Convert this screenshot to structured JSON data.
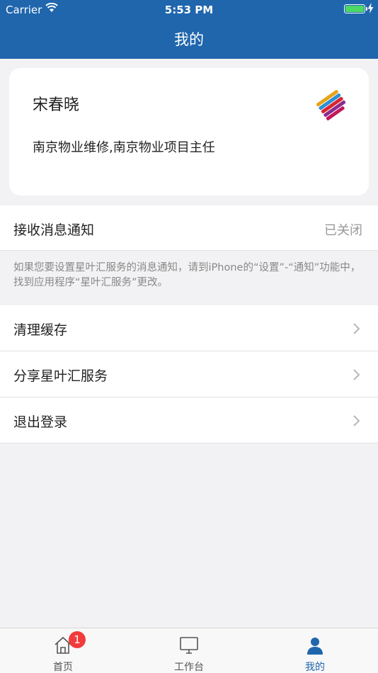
{
  "status_bar": {
    "carrier": "Carrier",
    "time": "5:53 PM",
    "battery_level": 1.0
  },
  "nav": {
    "title": "我的"
  },
  "profile": {
    "name": "宋春晓",
    "organization": "南京物业维修,南京物业项目主任"
  },
  "notification": {
    "label": "接收消息通知",
    "value": "已关闭",
    "hint": "如果您要设置星叶汇服务的消息通知，请到iPhone的“设置”-“通知”功能中，找到应用程序“星叶汇服务”更改。"
  },
  "actions": [
    {
      "label": "清理缓存",
      "icon": "chevron-right-icon"
    },
    {
      "label": "分享星叶汇服务",
      "icon": "chevron-right-icon"
    },
    {
      "label": "退出登录",
      "icon": "chevron-right-icon"
    }
  ],
  "tabs": [
    {
      "label": "首页",
      "icon": "home-icon",
      "badge": "1"
    },
    {
      "label": "工作台",
      "icon": "monitor-icon"
    },
    {
      "label": "我的",
      "icon": "user-icon",
      "active": true
    }
  ],
  "colors": {
    "primary": "#1f66ad",
    "badge": "#f23b3b",
    "background": "#f2f2f4",
    "battery": "#4cd964"
  }
}
